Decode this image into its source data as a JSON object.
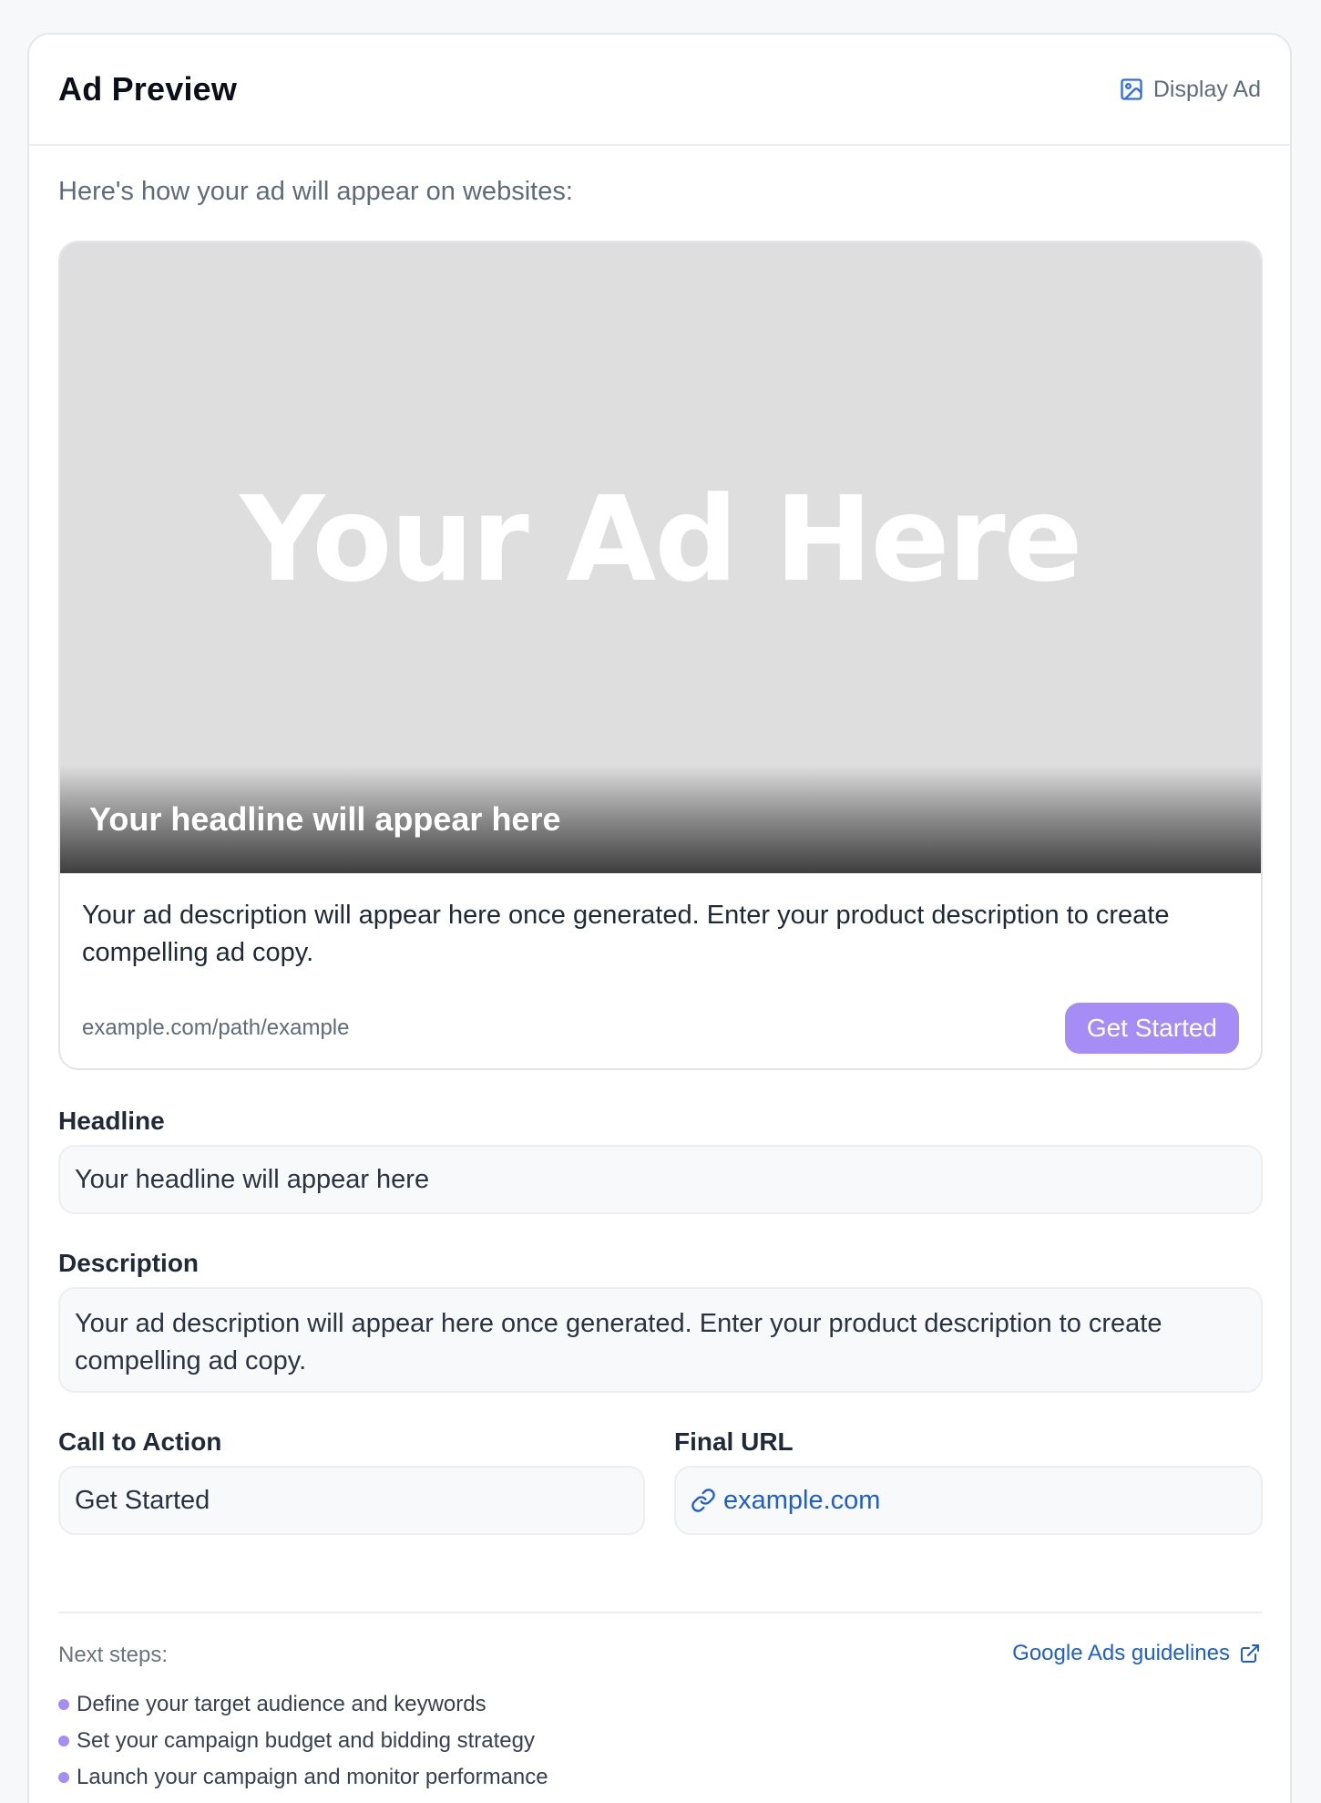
{
  "header": {
    "title": "Ad Preview",
    "badge_label": "Display Ad",
    "badge_icon": "image-icon"
  },
  "intro_text": "Here's how your ad will appear on websites:",
  "preview": {
    "image_placeholder": "Your Ad Here",
    "headline": "Your headline will appear here",
    "description": "Your ad description will appear here once generated. Enter your product description to create compelling ad copy.",
    "display_url": "example.com/path/example",
    "cta_label": "Get Started"
  },
  "fields": {
    "headline": {
      "label": "Headline",
      "value": "Your headline will appear here"
    },
    "description": {
      "label": "Description",
      "value": "Your ad description will appear here once generated. Enter your product description to create compelling ad copy."
    },
    "cta": {
      "label": "Call to Action",
      "value": "Get Started"
    },
    "final_url": {
      "label": "Final URL",
      "value": "example.com",
      "icon": "link-icon"
    }
  },
  "next_steps": {
    "label": "Next steps:",
    "guide_link": "Google Ads guidelines",
    "guide_icon": "external-link-icon",
    "items": [
      "Define your target audience and keywords",
      "Set your campaign budget and bidding strategy",
      "Launch your campaign and monitor performance"
    ]
  },
  "colors": {
    "accent": "#a58df5",
    "link": "#1d5fd1",
    "placeholder_bg": "#dedede"
  }
}
